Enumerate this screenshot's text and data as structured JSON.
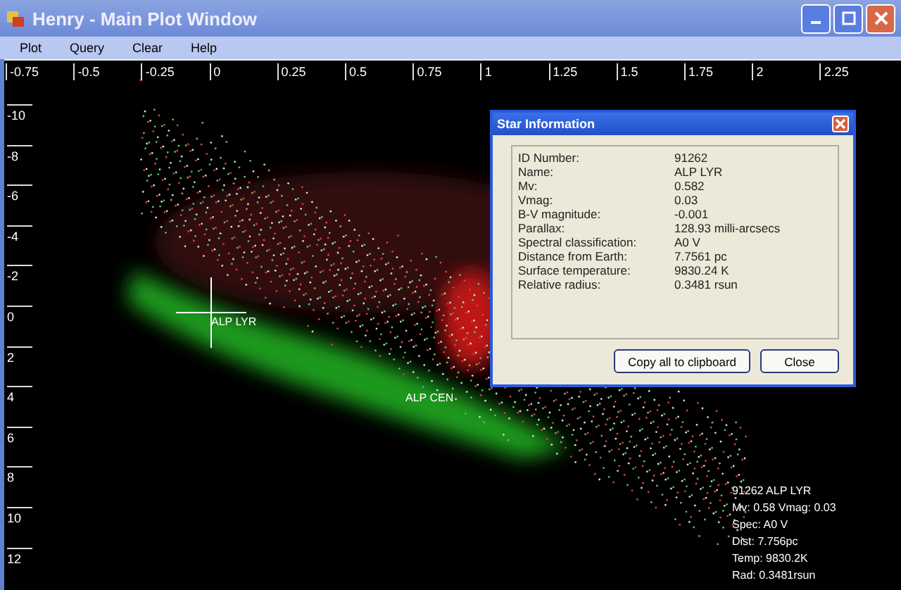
{
  "window": {
    "title": "Henry - Main Plot Window"
  },
  "menu": [
    "Plot",
    "Query",
    "Clear",
    "Help"
  ],
  "plot": {
    "x_ticks": [
      "-0.75",
      "-0.5",
      "-0.25",
      "0",
      "0.25",
      "0.5",
      "0.75",
      "1",
      "1.25",
      "1.5",
      "1.75",
      "2",
      "2.25"
    ],
    "y_ticks": [
      "-10",
      "-8",
      "-6",
      "-4",
      "-2",
      "0",
      "2",
      "4",
      "6",
      "8",
      "10",
      "12"
    ],
    "star_labels": [
      {
        "text": "ALP LYR",
        "kind": "crosshair"
      },
      {
        "text": "ALP CEN",
        "kind": "plain"
      }
    ],
    "info_lines": [
      "91262 ALP LYR",
      "Mv: 0.58 Vmag: 0.03",
      "Spec: A0 V",
      "Dist: 7.756pc",
      "Temp: 9830.2K",
      "Rad: 0.3481rsun"
    ]
  },
  "dialog": {
    "title": "Star Information",
    "fields": [
      {
        "label": "ID Number:",
        "value": "91262"
      },
      {
        "label": "Name:",
        "value": "ALP LYR"
      },
      {
        "label": "Mv:",
        "value": "0.582"
      },
      {
        "label": "Vmag:",
        "value": "0.03"
      },
      {
        "label": "B-V magnitude:",
        "value": "-0.001"
      },
      {
        "label": "Parallax:",
        "value": "128.93 milli-arcsecs"
      },
      {
        "label": "Spectral classification:",
        "value": "A0 V"
      },
      {
        "label": "Distance from Earth:",
        "value": "7.7561 pc"
      },
      {
        "label": "Surface temperature:",
        "value": "9830.24 K"
      },
      {
        "label": "Relative radius:",
        "value": "0.3481 rsun"
      }
    ],
    "buttons": [
      "Copy all to clipboard",
      "Close"
    ]
  }
}
